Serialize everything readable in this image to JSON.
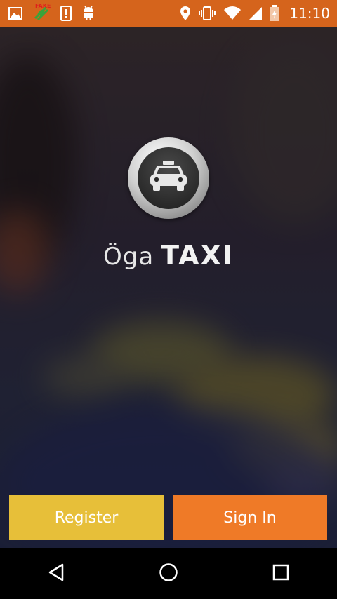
{
  "status_bar": {
    "time": "11:10",
    "left_icons": [
      "image-icon",
      "fake-gps-icon",
      "alert-icon",
      "android-icon"
    ],
    "right_icons": [
      "location-icon",
      "vibrate-icon",
      "wifi-icon",
      "signal-icon",
      "battery-icon"
    ],
    "fake_gps_label": "FAKE",
    "background": "#d5641c"
  },
  "brand": {
    "prefix": "Öga",
    "name": "TAXI"
  },
  "buttons": {
    "register_label": "Register",
    "signin_label": "Sign In",
    "register_color": "#e7bf39",
    "signin_color": "#ef7a27"
  },
  "nav_bar": {
    "items": [
      "back-icon",
      "home-icon",
      "recents-icon"
    ]
  }
}
